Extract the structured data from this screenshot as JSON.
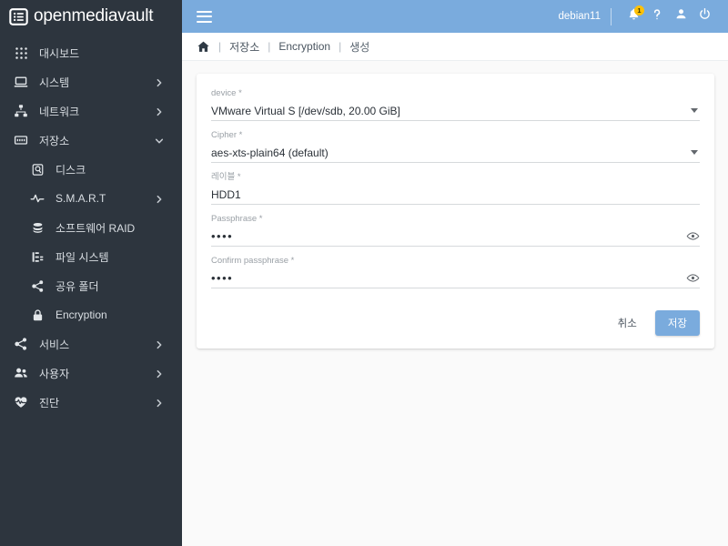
{
  "brand": {
    "name": "openmediavault",
    "icon": "list-box-icon"
  },
  "sidebar": {
    "items": [
      {
        "label": "대시보드",
        "icon": "grid-icon",
        "level": 0,
        "expandable": false
      },
      {
        "label": "시스템",
        "icon": "laptop-icon",
        "level": 0,
        "expandable": true,
        "state": "collapsed"
      },
      {
        "label": "네트워크",
        "icon": "network-icon",
        "level": 0,
        "expandable": true,
        "state": "collapsed"
      },
      {
        "label": "저장소",
        "icon": "storage-icon",
        "level": 0,
        "expandable": true,
        "state": "expanded"
      },
      {
        "label": "디스크",
        "icon": "disk-icon",
        "level": 1,
        "expandable": false
      },
      {
        "label": "S.M.A.R.T",
        "icon": "pulse-icon",
        "level": 1,
        "expandable": true,
        "state": "collapsed"
      },
      {
        "label": "소프트웨어 RAID",
        "icon": "database-icon",
        "level": 1,
        "expandable": false
      },
      {
        "label": "파일 시스템",
        "icon": "filesystem-icon",
        "level": 1,
        "expandable": false
      },
      {
        "label": "공유 폴더",
        "icon": "share-icon",
        "level": 1,
        "expandable": false
      },
      {
        "label": "Encryption",
        "icon": "lock-icon",
        "level": 1,
        "expandable": false
      },
      {
        "label": "서비스",
        "icon": "share-icon",
        "level": 0,
        "expandable": true,
        "state": "collapsed"
      },
      {
        "label": "사용자",
        "icon": "users-icon",
        "level": 0,
        "expandable": true,
        "state": "collapsed"
      },
      {
        "label": "진단",
        "icon": "heartbeat-icon",
        "level": 0,
        "expandable": true,
        "state": "collapsed"
      }
    ]
  },
  "topbar": {
    "menu_icon": "hamburger-icon",
    "user_name": "debian11",
    "notification_icon": "bell-icon",
    "notification_count": "1",
    "help_icon": "question-mark-icon",
    "account_icon": "person-icon",
    "power_icon": "power-icon",
    "background_color": "#7aabdd"
  },
  "breadcrumb": {
    "home_icon": "home-icon",
    "separator": "|",
    "items": [
      {
        "label": "저장소"
      },
      {
        "label": "Encryption"
      },
      {
        "label": "생성"
      }
    ]
  },
  "form": {
    "fields": [
      {
        "label": "device *",
        "value": "VMware Virtual S [/dev/sdb, 20.00 GiB]",
        "control": "select"
      },
      {
        "label": "Cipher *",
        "value": "aes-xts-plain64 (default)",
        "control": "select"
      },
      {
        "label": "레이블 *",
        "value": "HDD1",
        "control": "text"
      },
      {
        "label": "Passphrase *",
        "value": "••••",
        "control": "password"
      },
      {
        "label": "Confirm passphrase *",
        "value": "••••",
        "control": "password"
      }
    ],
    "cancel_label": "취소",
    "save_label": "저장",
    "save_color": "#7aabdd"
  }
}
